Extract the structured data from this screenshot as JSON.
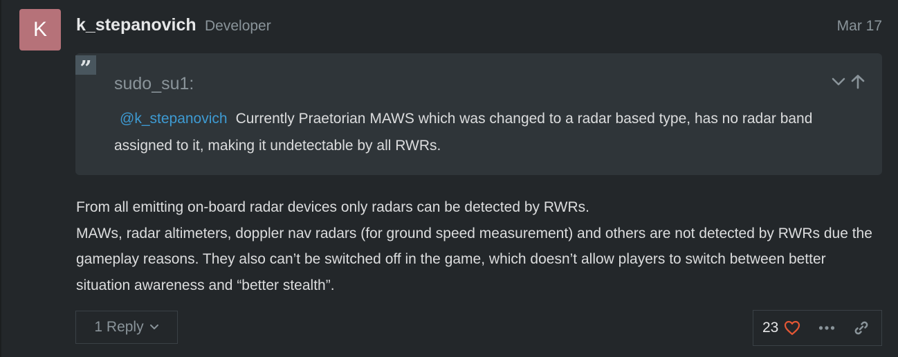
{
  "post": {
    "avatar_letter": "K",
    "username": "k_stepanovich",
    "user_title": "Developer",
    "date": "Mar 17"
  },
  "quote": {
    "author": "sudo_su1:",
    "mention": "@k_stepanovich",
    "text": "Currently Praetorian MAWS which was changed to a radar based type, has no radar band assigned to it, making it undetectable by all RWRs.",
    "icons": [
      "quote-mark-icon",
      "chevron-down-icon",
      "arrow-up-icon"
    ]
  },
  "body": {
    "paragraph1": "From all emitting on-board radar devices only radars can be detected by RWRs.",
    "paragraph2": "MAWs, radar altimeters, doppler nav radars (for ground speed measurement) and others are not detected by RWRs due the gameplay reasons. They also can’t be switched off in the game, which doesn’t allow players to switch between better situation awareness and “better stealth”."
  },
  "footer": {
    "replies_label": "1 Reply",
    "like_count": "23",
    "icons": [
      "heart-icon",
      "more-icon",
      "link-icon"
    ]
  },
  "colors": {
    "background": "#23272a",
    "quote_bg": "#2f3539",
    "avatar_bg": "#b67279",
    "mention": "#3e9bd3",
    "heart": "#e45735"
  }
}
